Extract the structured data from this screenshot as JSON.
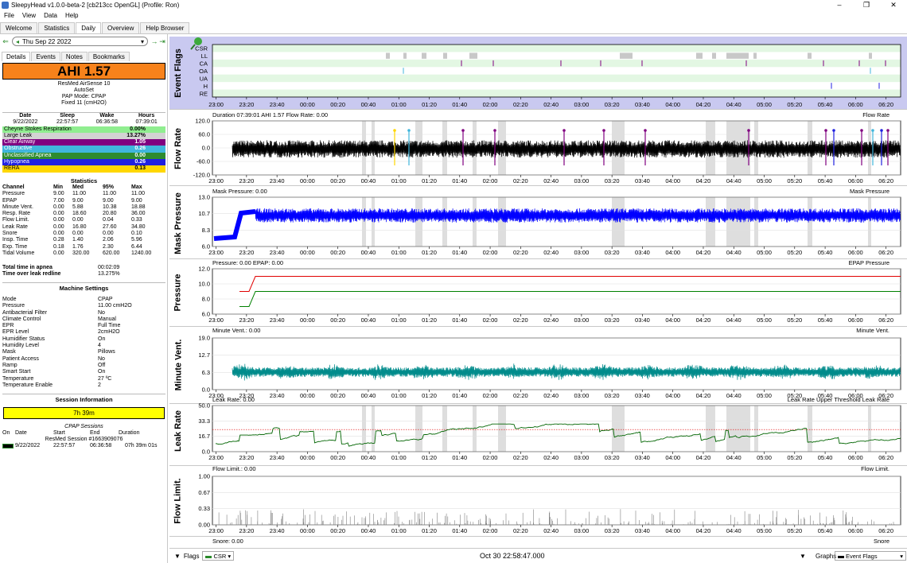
{
  "window": {
    "title": "SleepyHead v1.0.0-beta-2 [cb213cc OpenGL] (Profile: Ron)",
    "min": "–",
    "max": "❐",
    "close": "✕"
  },
  "menu": [
    "File",
    "View",
    "Data",
    "Help"
  ],
  "tabs": [
    "Welcome",
    "Statistics",
    "Daily",
    "Overview",
    "Help Browser"
  ],
  "date": "Thu Sep 22 2022",
  "subtabs": [
    "Details",
    "Events",
    "Notes",
    "Bookmarks"
  ],
  "ahi": "AHI 1.57",
  "machine": [
    "ResMed AirSense 10",
    "AutoSet",
    "PAP Mode: CPAP",
    "Fixed 11 (cmH2O)"
  ],
  "sleep_header": [
    "Date",
    "Sleep",
    "Wake",
    "Hours"
  ],
  "sleep_row": [
    "9/22/2022",
    "22:57:57",
    "06:36:58",
    "07:39:01"
  ],
  "events": [
    {
      "name": "Cheyne Stokes Respiration",
      "value": "0.00%",
      "color": "#90ee90"
    },
    {
      "name": "Large Leak",
      "value": "13.27%",
      "color": "#d3d3d3"
    },
    {
      "name": "Clear Airway",
      "value": "1.05",
      "color": "#800080"
    },
    {
      "name": "Obstructive",
      "value": "0.26",
      "color": "#40b6dc"
    },
    {
      "name": "Unclassified Apnea",
      "value": "0.00",
      "color": "#2e8b2e"
    },
    {
      "name": "Hypopnea",
      "value": "0.26",
      "color": "#2020e0"
    },
    {
      "name": "RERA",
      "value": "0.13",
      "color": "#ffd700"
    }
  ],
  "stats_title": "Statistics",
  "stats_header": [
    "Channel",
    "Min",
    "Med",
    "95%",
    "Max"
  ],
  "stats": [
    [
      "Pressure",
      "9.00",
      "11.00",
      "11.00",
      "11.00"
    ],
    [
      "EPAP",
      "7.00",
      "9.00",
      "9.00",
      "9.00"
    ],
    [
      "Minute Vent.",
      "0.00",
      "5.88",
      "10.38",
      "18.88"
    ],
    [
      "Resp. Rate",
      "0.00",
      "18.60",
      "20.80",
      "36.00"
    ],
    [
      "Flow Limit.",
      "0.00",
      "0.00",
      "0.04",
      "0.33"
    ],
    [
      "Leak Rate",
      "0.00",
      "16.80",
      "27.60",
      "34.80"
    ],
    [
      "Snore",
      "0.00",
      "0.00",
      "0.00",
      "0.10"
    ],
    [
      "Insp. Time",
      "0.28",
      "1.40",
      "2.06",
      "5.96"
    ],
    [
      "Exp. Time",
      "0.18",
      "1.76",
      "2.30",
      "6.44"
    ],
    [
      "Tidal Volume",
      "0.00",
      "320.00",
      "620.00",
      "1240.00"
    ]
  ],
  "apnea": [
    [
      "Total time in apnea",
      "00:02:09"
    ],
    [
      "Time over leak redline",
      "13.275%"
    ]
  ],
  "settings_title": "Machine Settings",
  "settings": [
    [
      "Mode",
      "CPAP"
    ],
    [
      "Pressure",
      "11.00 cmH2O"
    ],
    [
      "Antibacterial Filter",
      "No"
    ],
    [
      "Climate Control",
      "Manual"
    ],
    [
      "EPR",
      "Full Time"
    ],
    [
      "EPR Level",
      "2cmH2O"
    ],
    [
      "Humidifier Status",
      "On"
    ],
    [
      "Humidity Level",
      "4"
    ],
    [
      "Mask",
      "Pillows"
    ],
    [
      "Patient Access",
      "No"
    ],
    [
      "Ramp",
      "Off"
    ],
    [
      "Smart Start",
      "On"
    ],
    [
      "Temperature",
      "27 ºC"
    ],
    [
      "Temperature Enable",
      "2"
    ]
  ],
  "session_title": "Session Information",
  "session_bar": "7h 39m",
  "cpap_sessions": "CPAP Sessions",
  "sess_header": [
    "On",
    "Date",
    "Start",
    "End",
    "Duration"
  ],
  "sess_name": "ResMed Session #1663909076",
  "sess_row": [
    "9/22/2022",
    "22:57:57",
    "06:36:58",
    "07h 39m 01s"
  ],
  "time_ticks": [
    "23:00",
    "23:20",
    "23:40",
    "00:00",
    "00:20",
    "00:40",
    "01:00",
    "01:20",
    "01:40",
    "02:00",
    "02:20",
    "02:40",
    "03:00",
    "03:20",
    "03:40",
    "04:00",
    "04:20",
    "04:40",
    "05:00",
    "05:20",
    "05:40",
    "06:00",
    "06:20"
  ],
  "flag_labels": [
    "CSR",
    "LL",
    "CA",
    "OA",
    "UA",
    "H",
    "RE"
  ],
  "panels": {
    "flags": {
      "label": "Event Flags"
    },
    "flow": {
      "label": "Flow Rate",
      "title": "Duration 07:39:01 AHI 1.57 Flow Rate: 0.00",
      "legend": "Flow Rate",
      "yticks": [
        "120.0",
        "60.0",
        "0.0",
        "-60.0",
        "-120.0"
      ],
      "color": "#000000"
    },
    "mask": {
      "label": "Mask Pressure",
      "title": "Mask Pressure: 0.00",
      "legend": "Mask Pressure",
      "yticks": [
        "13.0",
        "10.7",
        "8.3",
        "6.0"
      ],
      "color": "#0000ff"
    },
    "pressure": {
      "label": "Pressure",
      "title": "Pressure: 0.00 EPAP: 0.00",
      "legend": "EPAP  Pressure",
      "yticks": [
        "12.0",
        "10.0",
        "8.0",
        "6.0"
      ]
    },
    "minvent": {
      "label": "Minute Vent.",
      "title": "Minute Vent.: 0.00",
      "legend": "Minute Vent.",
      "yticks": [
        "19.0",
        "12.7",
        "6.3",
        "0.0"
      ],
      "color": "#008b8b"
    },
    "leak": {
      "label": "Leak Rate",
      "title": "Leak Rate: 0.00",
      "legend": "Leak Rate Upper Threshold  Leak Rate",
      "yticks": [
        "50.0",
        "33.3",
        "16.7",
        "0.0"
      ],
      "color": "#006400"
    },
    "flowlim": {
      "label": "Flow Limit.",
      "title": "Flow Limit.: 0.00",
      "legend": "Flow Limit.",
      "yticks": [
        "1.00",
        "0.67",
        "0.33",
        "0.00"
      ],
      "color": "#808080"
    },
    "snore": {
      "title": "Snore: 0.00",
      "legend": "Snore"
    }
  },
  "bottom": {
    "flags": "Flags",
    "csr": "CSR",
    "time": "Oct 30 22:58:47.000",
    "graphs": "Graphs",
    "eventflags": "Event Flags"
  }
}
